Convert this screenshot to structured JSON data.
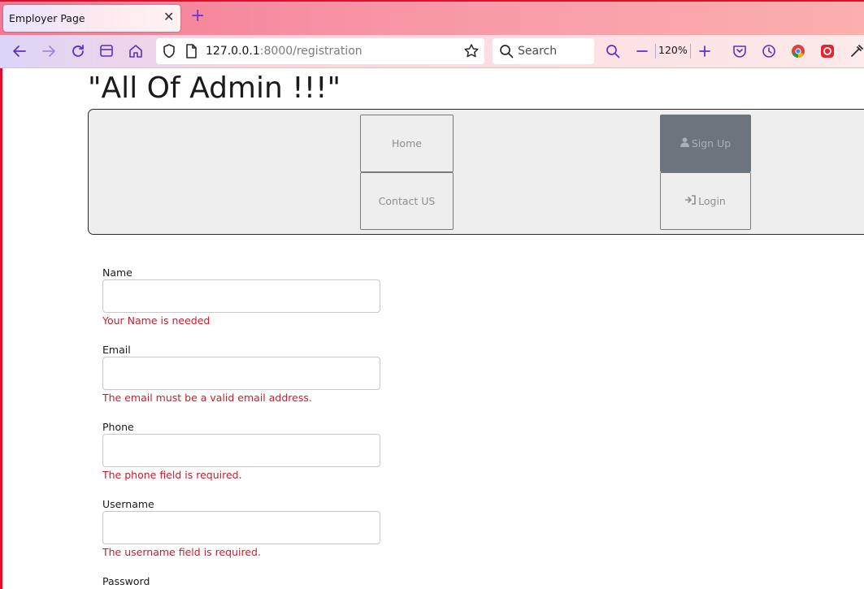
{
  "browser": {
    "tab_title": "Employer Page",
    "url_host": "127.0.0.1",
    "url_rest": ":8000/registration",
    "search_placeholder": "Search",
    "zoom": "120%"
  },
  "site": {
    "title": "\"All Of Admin !!!\""
  },
  "nav": {
    "home": "Home",
    "contact": "Contact US",
    "signup": "Sign Up",
    "login": "Login"
  },
  "form": {
    "name_label": "Name",
    "name_error": "Your Name is needed",
    "email_label": "Email",
    "email_error": "The email must be a valid email address.",
    "phone_label": "Phone",
    "phone_error": "The phone field is required.",
    "username_label": "Username",
    "username_error": "The username field is required.",
    "password_label": "Password"
  },
  "colors": {
    "accent": "#5b2fc4",
    "error": "#d11a2a",
    "active_button": "#6c757d"
  }
}
